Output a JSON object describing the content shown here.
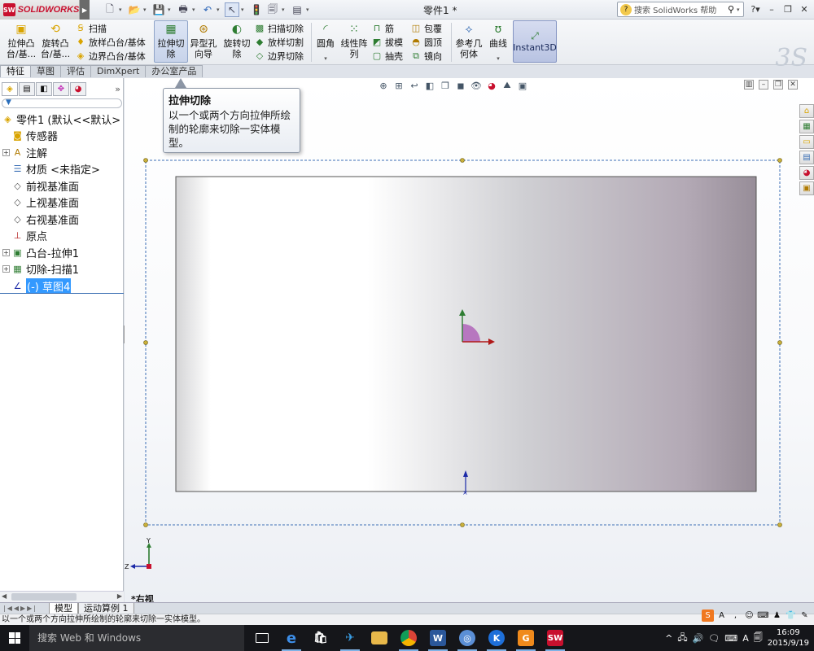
{
  "app": {
    "brand": "SOLIDWORKS",
    "badge": "SW",
    "doc_title": "零件1 *"
  },
  "help_search": {
    "placeholder": "搜索 SolidWorks 帮助"
  },
  "ribbon": {
    "extrude_boss": "拉伸凸\n台/基...",
    "revolve_boss": "旋转凸\n台/基...",
    "sweep": "扫描",
    "loft_boss": "放样凸台/基体",
    "boundary_boss": "边界凸台/基体",
    "extrude_cut": "拉伸切\n除",
    "hole_wizard": "异型孔\n向导",
    "revolve_cut": "旋转切\n除",
    "swept_cut": "扫描切除",
    "lofted_cut": "放样切割",
    "boundary_cut": "边界切除",
    "fillet": "圆角",
    "linear_pattern": "线性阵\n列",
    "rib": "筋",
    "draft": "拔模",
    "shell": "抽壳",
    "wrap": "包覆",
    "dome": "圆顶",
    "mirror": "镜向",
    "ref_geometry": "参考几\n何体",
    "curves": "曲线",
    "instant3d": "Instant3D"
  },
  "cm_tabs": [
    "特征",
    "草图",
    "评估",
    "DimXpert",
    "办公室产品"
  ],
  "tooltip": {
    "title": "拉伸切除",
    "body": "以一个或两个方向拉伸所绘制的轮廓来切除一实体模型。"
  },
  "tree": {
    "root": "零件1 (默认<<默认>",
    "items": [
      {
        "label": "传感器",
        "icon": "sensor-icon",
        "expandable": false
      },
      {
        "label": "注解",
        "icon": "annotation-icon",
        "expandable": true
      },
      {
        "label": "材质 <未指定>",
        "icon": "material-icon",
        "expandable": false
      },
      {
        "label": "前视基准面",
        "icon": "plane-icon",
        "expandable": false
      },
      {
        "label": "上视基准面",
        "icon": "plane-icon",
        "expandable": false
      },
      {
        "label": "右视基准面",
        "icon": "plane-icon",
        "expandable": false
      },
      {
        "label": "原点",
        "icon": "origin-icon",
        "expandable": false
      },
      {
        "label": "凸台-拉伸1",
        "icon": "extrude-feature-icon",
        "expandable": true
      },
      {
        "label": "切除-扫描1",
        "icon": "cut-sweep-feature-icon",
        "expandable": true
      },
      {
        "label": "(-) 草图4",
        "icon": "sketch-icon",
        "expandable": false,
        "selected": true
      }
    ]
  },
  "graphics": {
    "view_label": "*右视",
    "triad": {
      "y": "Y",
      "z": "Z"
    }
  },
  "model_tabs": [
    "模型",
    "运动算例 1"
  ],
  "status_bar": {
    "text": "以一个或两个方向拉伸所绘制的轮廓来切除一实体模型。"
  },
  "taskbar": {
    "search_placeholder": "搜索 Web 和 Windows",
    "ime": "A",
    "clock_time": "16:09",
    "clock_date": "2015/9/19"
  },
  "colors": {
    "accent": "#3399ff",
    "sw_red": "#c8102e",
    "instant3d_bg": "#c1cae6",
    "model_face_end": "#978d98",
    "origin_arc": "#b36bbb"
  }
}
